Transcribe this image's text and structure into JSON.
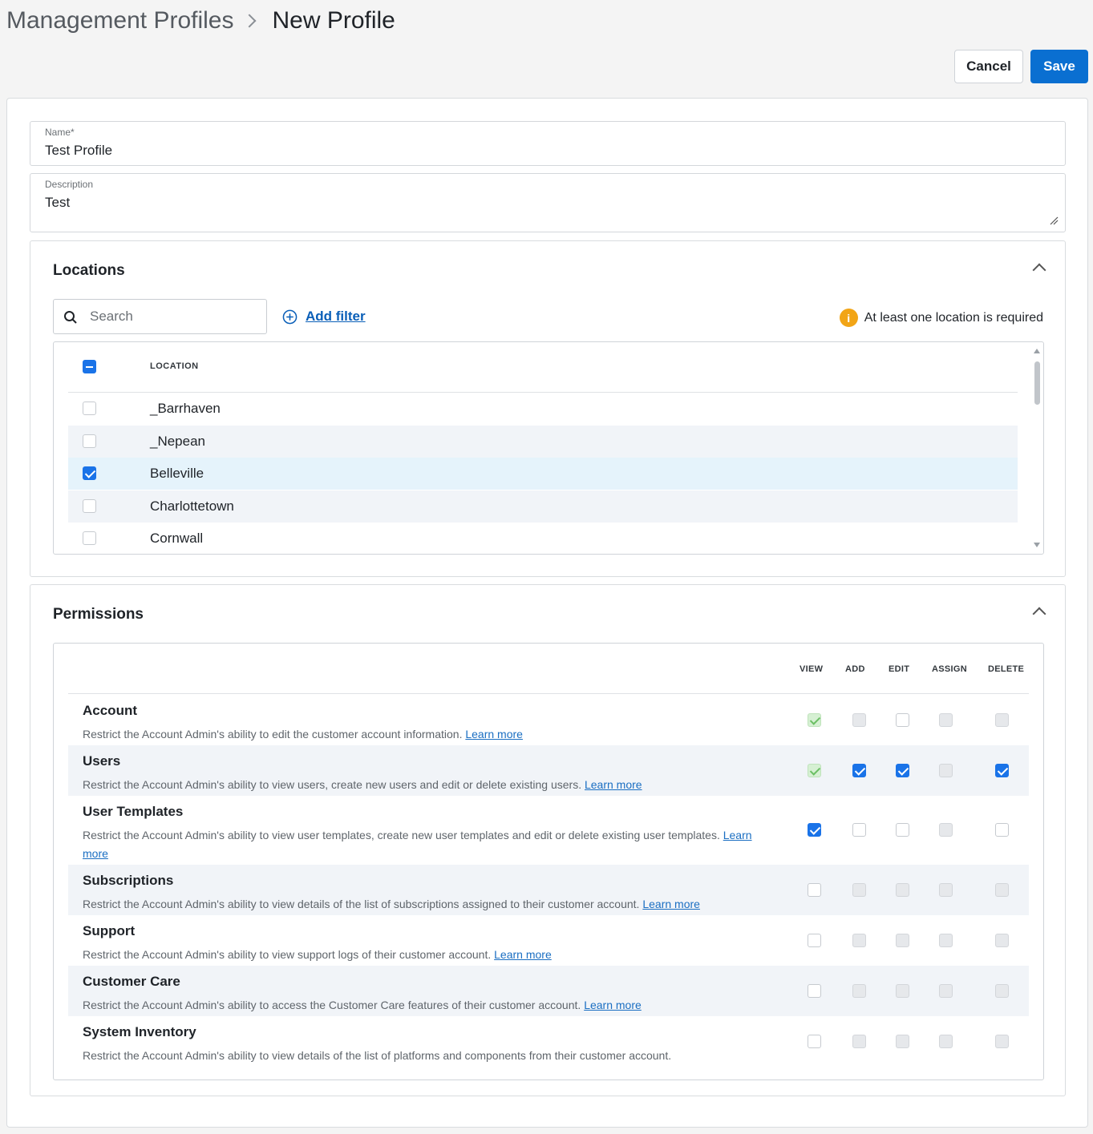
{
  "breadcrumb": {
    "parent": "Management Profiles",
    "current": "New Profile"
  },
  "actions": {
    "cancel": "Cancel",
    "save": "Save"
  },
  "form": {
    "name": {
      "label": "Name*",
      "value": "Test Profile"
    },
    "description": {
      "label": "Description",
      "value": "Test"
    }
  },
  "locations": {
    "title": "Locations",
    "search_placeholder": "Search",
    "add_filter": "Add filter",
    "warning": "At least one location is required",
    "column": "LOCATION",
    "rows": [
      {
        "name": "_Barrhaven",
        "checked": false
      },
      {
        "name": "_Nepean",
        "checked": false
      },
      {
        "name": "Belleville",
        "checked": true
      },
      {
        "name": "Charlottetown",
        "checked": false
      },
      {
        "name": "Cornwall",
        "checked": false
      }
    ]
  },
  "permissions": {
    "title": "Permissions",
    "columns": [
      "VIEW",
      "ADD",
      "EDIT",
      "ASSIGN",
      "DELETE"
    ],
    "learn_more": "Learn more",
    "rows": [
      {
        "name": "Account",
        "desc": "Restrict the Account Admin's ability to edit the customer account information.",
        "learn": true,
        "states": [
          "ondis",
          "dis",
          "off",
          "dis",
          "dis"
        ]
      },
      {
        "name": "Users",
        "desc": "Restrict the Account Admin's ability to view users, create new users and edit or delete existing users.",
        "learn": true,
        "states": [
          "ondis",
          "on",
          "on",
          "dis",
          "on"
        ]
      },
      {
        "name": "User Templates",
        "desc": "Restrict the Account Admin's ability to view user templates, create new user templates and edit or delete existing user templates.",
        "learn": true,
        "states": [
          "on",
          "off",
          "off",
          "dis",
          "off"
        ]
      },
      {
        "name": "Subscriptions",
        "desc": "Restrict the Account Admin's ability to view details of the list of subscriptions assigned to their customer account.",
        "learn": true,
        "states": [
          "off",
          "dis",
          "dis",
          "dis",
          "dis"
        ]
      },
      {
        "name": "Support",
        "desc": "Restrict the Account Admin's ability to view support logs of their customer account.",
        "learn": true,
        "states": [
          "off",
          "dis",
          "dis",
          "dis",
          "dis"
        ]
      },
      {
        "name": "Customer Care",
        "desc": "Restrict the Account Admin's ability to access the Customer Care features of their customer account.",
        "learn": true,
        "states": [
          "off",
          "dis",
          "dis",
          "dis",
          "dis"
        ]
      },
      {
        "name": "System Inventory",
        "desc": "Restrict the Account Admin's ability to view details of the list of platforms and components from their customer account.",
        "learn": false,
        "states": [
          "off",
          "dis",
          "dis",
          "dis",
          "dis"
        ]
      }
    ]
  },
  "colors": {
    "accent": "#1a73e8",
    "save": "#0a6fd1",
    "warning": "#f2a516",
    "link": "#1a6ec2"
  }
}
